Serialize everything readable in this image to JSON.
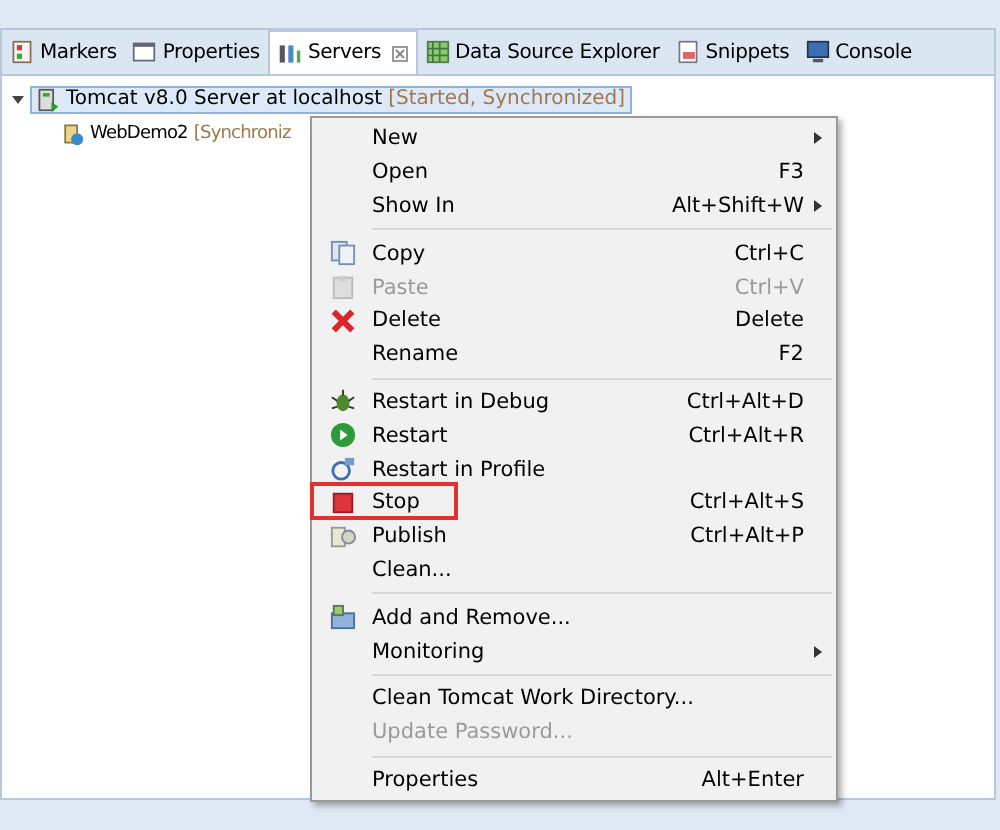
{
  "tabs": [
    {
      "label": "Markers",
      "selected": false,
      "closable": false
    },
    {
      "label": "Properties",
      "selected": false,
      "closable": false
    },
    {
      "label": "Servers",
      "selected": true,
      "closable": true
    },
    {
      "label": "Data Source Explorer",
      "selected": false,
      "closable": false
    },
    {
      "label": "Snippets",
      "selected": false,
      "closable": false
    },
    {
      "label": "Console",
      "selected": false,
      "closable": false
    }
  ],
  "tree": [
    {
      "label": "Tomcat v8.0 Server at localhost",
      "status": "[Started, Synchronized]",
      "expanded": true,
      "selected": true,
      "children": [
        {
          "label": "WebDemo2",
          "status": "[Synchroniz",
          "selected": false
        }
      ]
    }
  ],
  "context_menu": [
    {
      "kind": "item",
      "label": "New",
      "submenu": true,
      "disabled": false
    },
    {
      "kind": "item",
      "label": "Open",
      "shortcut": "F3",
      "disabled": false
    },
    {
      "kind": "item",
      "label": "Show In",
      "shortcut": "Alt+Shift+W",
      "submenu": true,
      "disabled": false
    },
    {
      "kind": "separator"
    },
    {
      "kind": "item",
      "label": "Copy",
      "shortcut": "Ctrl+C",
      "disabled": false
    },
    {
      "kind": "item",
      "label": "Paste",
      "shortcut": "Ctrl+V",
      "disabled": true
    },
    {
      "kind": "item",
      "label": "Delete",
      "shortcut": "Delete",
      "disabled": false
    },
    {
      "kind": "item",
      "label": "Rename",
      "shortcut": "F2",
      "disabled": false
    },
    {
      "kind": "separator"
    },
    {
      "kind": "item",
      "label": "Restart in Debug",
      "shortcut": "Ctrl+Alt+D",
      "disabled": false
    },
    {
      "kind": "item",
      "label": "Restart",
      "shortcut": "Ctrl+Alt+R",
      "disabled": false
    },
    {
      "kind": "item",
      "label": "Restart in Profile",
      "disabled": false
    },
    {
      "kind": "item",
      "label": "Stop",
      "shortcut": "Ctrl+Alt+S",
      "disabled": false,
      "highlighted": true
    },
    {
      "kind": "item",
      "label": "Publish",
      "shortcut": "Ctrl+Alt+P",
      "disabled": false
    },
    {
      "kind": "item",
      "label": "Clean...",
      "disabled": false
    },
    {
      "kind": "separator"
    },
    {
      "kind": "item",
      "label": "Add and Remove...",
      "disabled": false
    },
    {
      "kind": "item",
      "label": "Monitoring",
      "submenu": true,
      "disabled": false
    },
    {
      "kind": "separator"
    },
    {
      "kind": "item",
      "label": "Clean Tomcat Work Directory...",
      "disabled": false
    },
    {
      "kind": "item",
      "label": "Update Password...",
      "disabled": true
    },
    {
      "kind": "separator"
    },
    {
      "kind": "item",
      "label": "Properties",
      "shortcut": "Alt+Enter",
      "disabled": false
    }
  ]
}
